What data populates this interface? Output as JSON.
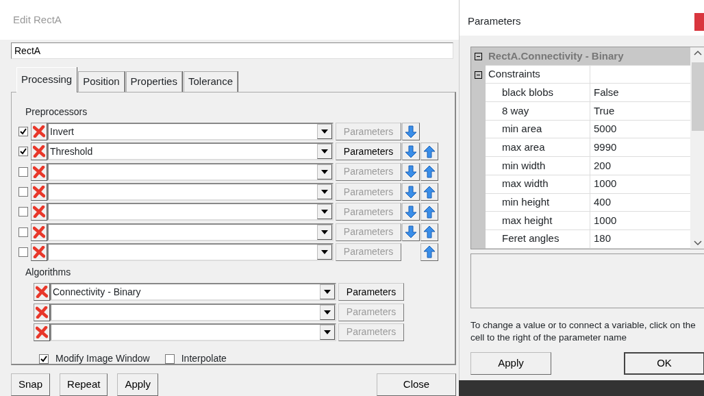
{
  "edit_window": {
    "title": "Edit RectA",
    "name_value": "RectA",
    "tabs": [
      {
        "label": "Processing",
        "selected": true
      },
      {
        "label": "Position",
        "selected": false
      },
      {
        "label": "Properties",
        "selected": false
      },
      {
        "label": "Tolerance",
        "selected": false
      }
    ],
    "preprocessors": {
      "heading": "Preprocessors",
      "rows": [
        {
          "checked": true,
          "value": "Invert",
          "parameters": "Parameters",
          "parameters_enabled": false,
          "move_down": true,
          "move_up": false
        },
        {
          "checked": true,
          "value": "Threshold",
          "parameters": "Parameters",
          "parameters_enabled": true,
          "move_down": true,
          "move_up": true
        },
        {
          "checked": false,
          "parameters": "Parameters",
          "parameters_enabled": false,
          "move_down": true,
          "move_up": true
        },
        {
          "checked": false,
          "parameters": "Parameters",
          "parameters_enabled": false,
          "move_down": true,
          "move_up": true
        },
        {
          "checked": false,
          "parameters": "Parameters",
          "parameters_enabled": false,
          "move_down": true,
          "move_up": true
        },
        {
          "checked": false,
          "parameters": "Parameters",
          "parameters_enabled": false,
          "move_down": true,
          "move_up": true
        },
        {
          "checked": false,
          "parameters": "Parameters",
          "parameters_enabled": false,
          "move_down": false,
          "move_up": true
        }
      ]
    },
    "algorithms": {
      "heading": "Algorithms",
      "rows": [
        {
          "value": "Connectivity - Binary",
          "parameters": "Parameters",
          "parameters_enabled": true
        },
        {
          "parameters": "Parameters",
          "parameters_enabled": false
        },
        {
          "parameters": "Parameters",
          "parameters_enabled": false
        }
      ]
    },
    "options": [
      {
        "label": "Modify Image Window",
        "checked": true
      },
      {
        "label": "Interpolate",
        "checked": false
      }
    ],
    "buttons": [
      "Snap",
      "Repeat",
      "Apply"
    ],
    "close_button": "Close"
  },
  "parameters_window": {
    "title": "Parameters",
    "grid": {
      "title": "RectA.Connectivity - Binary",
      "expanded": true,
      "category": {
        "label": "Constraints",
        "expanded": true,
        "rows": [
          {
            "name": "black blobs",
            "value": "False"
          },
          {
            "name": "8 way",
            "value": "True"
          },
          {
            "name": "min area",
            "value": "5000"
          },
          {
            "name": "max area",
            "value": "9990"
          },
          {
            "name": "min width",
            "value": "200"
          },
          {
            "name": "max width",
            "value": "1000"
          },
          {
            "name": "min height",
            "value": "400"
          },
          {
            "name": "max height",
            "value": "1000"
          },
          {
            "name": "Feret angles",
            "value": "180"
          }
        ]
      }
    },
    "help_text": "To change a value or to connect a variable, click on the cell to the right of the parameter name",
    "buttons": [
      "Apply",
      "OK"
    ]
  }
}
